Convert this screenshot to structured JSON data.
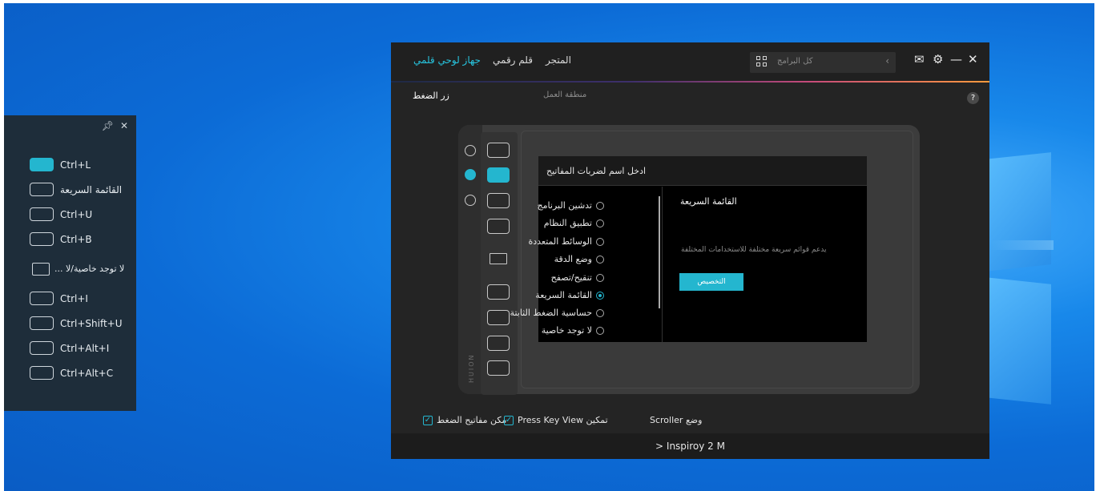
{
  "float_panel": {
    "pin_icon": "pin-icon",
    "close_icon": "close-icon",
    "items": [
      {
        "label": "Ctrl+L",
        "active": true
      },
      {
        "label": "القائمة السريعة",
        "active": false
      },
      {
        "label": "Ctrl+U",
        "active": false
      },
      {
        "label": "Ctrl+B",
        "active": false
      },
      {
        "label": "... لا توجد خاصية/لا",
        "active": false
      },
      {
        "label": "Ctrl+I",
        "active": false
      },
      {
        "label": "Ctrl+Shift+U",
        "active": false
      },
      {
        "label": "Ctrl+Alt+I",
        "active": false
      },
      {
        "label": "Ctrl+Alt+C",
        "active": false
      }
    ]
  },
  "app": {
    "nav": {
      "tablet": "جهاز لوحي قلمي",
      "pen": "قلم رقمي",
      "store": "المتجر"
    },
    "search": {
      "placeholder": "كل البرامج"
    },
    "tabs": {
      "press_keys": "زر الضغط",
      "work_area": "منطقة العمل"
    },
    "help_label": "?",
    "dialog": {
      "title": "ادخل اسم لضربات المفاتيح",
      "options": [
        "تدشين البرنامج",
        "تطبيق النظام",
        "الوسائط المتعددة",
        "وضع الدقة",
        "تنقيح/تصفح",
        "القائمة السريعة",
        "حساسية الضغط الثابتة",
        "لا توجد خاصية"
      ],
      "selected_index": 5,
      "detail_title": "القائمة السريعة",
      "detail_desc": "يدعم قوائم سريعة مختلفة للاستخدامات المختلفة",
      "customize_button": "التخصيص"
    },
    "bottom": {
      "enable_keys": "مكن مفاتيح الضغط",
      "press_key_view": "Press Key View تمكين",
      "scroller_mode": "Scroller وضع",
      "device_name": "Inspiroy 2 M",
      "device_chevron": ">"
    },
    "tablet_brand": "HUION"
  },
  "colors": {
    "accent": "#24b6cf",
    "panel_bg": "#1e2d3a",
    "app_bg": "#242424"
  }
}
